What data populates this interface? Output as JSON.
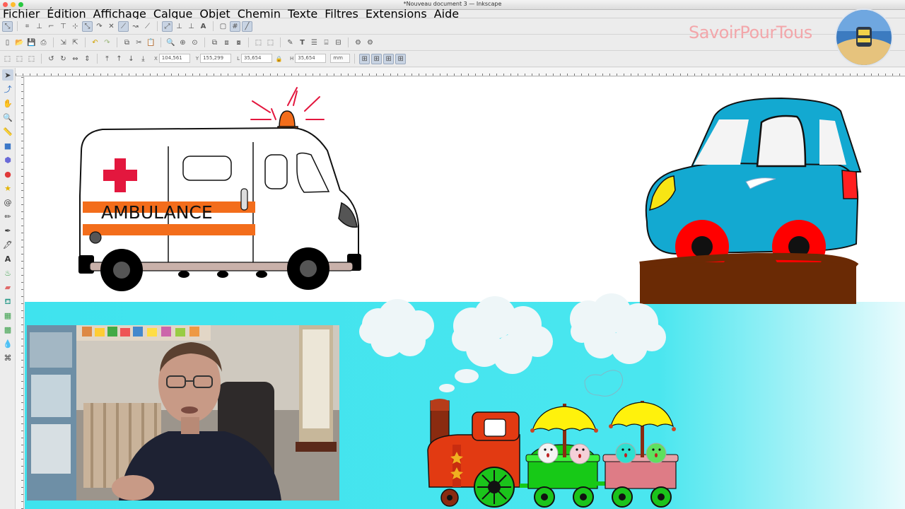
{
  "window": {
    "title": "*Nouveau document 3 — Inkscape",
    "traffic_colors": [
      "#fd5f57",
      "#febc2e",
      "#28c840"
    ]
  },
  "menubar": {
    "items": [
      "Fichier",
      "Édition",
      "Affichage",
      "Calque",
      "Objet",
      "Chemin",
      "Texte",
      "Filtres",
      "Extensions",
      "Aide"
    ]
  },
  "toolbar": {
    "x_label": "X",
    "x_value": "104,561",
    "y_label": "Y",
    "y_value": "155,299",
    "w_label": "L",
    "w_value": "35,654",
    "h_label": "H",
    "h_value": "35,654",
    "unit": "mm"
  },
  "watermark": {
    "brand": "SavoirPourTous",
    "color": "#f3a6aa"
  },
  "canvas": {
    "ambulance_text": "AMBULANCE",
    "sky_color": "#3fe3ee",
    "ground_color": "#6a2a05",
    "car_color": "#13a9d1"
  },
  "tools": [
    "selector-icon",
    "node-icon",
    "tweak-icon",
    "zoom-icon",
    "measure-icon",
    "rectangle-icon",
    "3dbox-icon",
    "ellipse-icon",
    "star-icon",
    "spiral-icon",
    "pencil-icon",
    "pen-icon",
    "calligraphy-icon",
    "text-icon",
    "spray-icon",
    "eraser-icon",
    "bucket-icon",
    "gradient-icon",
    "mesh-icon",
    "dropper-icon",
    "connector-icon"
  ]
}
